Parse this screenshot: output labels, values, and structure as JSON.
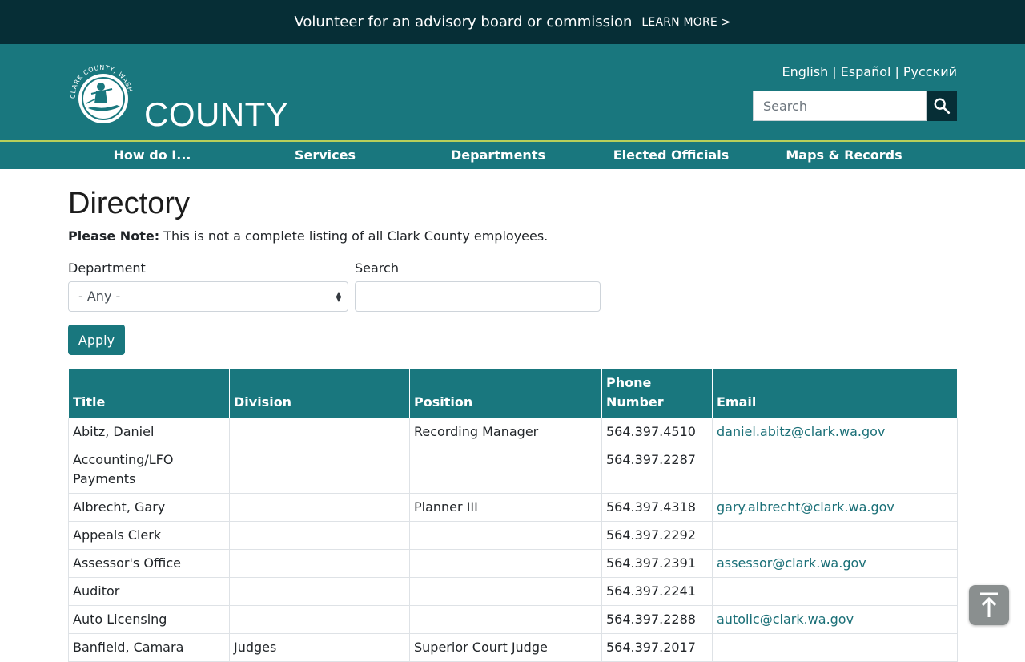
{
  "banner": {
    "text": "Volunteer for an advisory board or commission",
    "link": "LEARN MORE >"
  },
  "header": {
    "seal_text": "CLARK COUNTY, WASHINGTON",
    "county_word": "COUNTY",
    "languages": [
      "English",
      "Español",
      "Русский"
    ],
    "search_placeholder": "Search",
    "search_icon": "search-icon"
  },
  "nav": {
    "items": [
      "How do I...",
      "Services",
      "Departments",
      "Elected Officials",
      "Maps & Records"
    ]
  },
  "main": {
    "title": "Directory",
    "note_label": "Please Note:",
    "note_text": " This is not a complete listing of all Clark County employees.",
    "department_label": "Department",
    "department_value": "- Any -",
    "search_label": "Search",
    "apply_label": "Apply"
  },
  "table": {
    "headers": [
      "Title",
      "Division",
      "Position",
      "Phone Number",
      "Email"
    ],
    "rows": [
      [
        "Abitz, Daniel",
        "",
        "Recording Manager",
        "564.397.4510",
        "daniel.abitz@clark.wa.gov"
      ],
      [
        "Accounting/LFO Payments",
        "",
        "",
        "564.397.2287",
        ""
      ],
      [
        "Albrecht, Gary",
        "",
        "Planner III",
        "564.397.4318",
        "gary.albrecht@clark.wa.gov"
      ],
      [
        "Appeals Clerk",
        "",
        "",
        "564.397.2292",
        ""
      ],
      [
        "Assessor's Office",
        "",
        "",
        "564.397.2391",
        "assessor@clark.wa.gov"
      ],
      [
        "Auditor",
        "",
        "",
        "564.397.2241",
        ""
      ],
      [
        "Auto Licensing",
        "",
        "",
        "564.397.2288",
        "autolic@clark.wa.gov"
      ],
      [
        "Banfield, Camara",
        "Judges",
        "Superior Court Judge",
        "564.397.2017",
        ""
      ]
    ]
  },
  "colors": {
    "banner": "#062e36",
    "brand": "#19777e",
    "accent_line": "#b7cf5a",
    "link": "#1a6f77"
  },
  "back_to_top_icon": "arrow-up-to-line-icon"
}
